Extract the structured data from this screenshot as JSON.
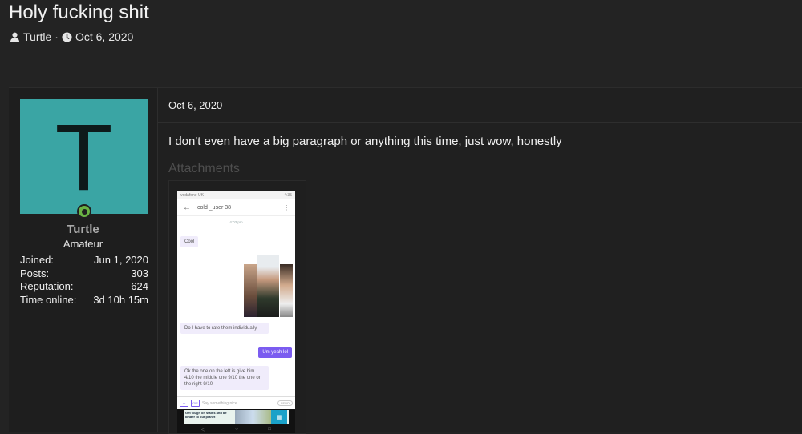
{
  "thread": {
    "title": "Holy fucking shit",
    "author": "Turtle",
    "separator": "·",
    "date": "Oct 6, 2020"
  },
  "user": {
    "avatar_letter": "T",
    "username": "Turtle",
    "title": "Amateur",
    "stats": [
      {
        "label": "Joined:",
        "value": "Jun 1, 2020"
      },
      {
        "label": "Posts:",
        "value": "303"
      },
      {
        "label": "Reputation:",
        "value": "624"
      },
      {
        "label": "Time online:",
        "value": "3d 10h 15m"
      }
    ]
  },
  "post": {
    "date": "Oct 6, 2020",
    "body": "I don't even have a big paragraph or anything this time, just wow, honestly",
    "attachments_label": "Attachments"
  },
  "screenshot": {
    "carrier": "vodafone UK",
    "clock": "4:35",
    "contact": "cold _user 38",
    "time_divider": "4:03 pm",
    "messages": [
      {
        "dir": "in",
        "text": "Cool"
      },
      {
        "dir": "in",
        "text": "Do I have to rate them individually"
      },
      {
        "dir": "out",
        "text": "Um yeah lol"
      },
      {
        "dir": "in",
        "text": "Ok the one on the left is give him 4/10  the middle one 9/10 the one on the right 9/10"
      }
    ],
    "input_placeholder": "Say something nice...",
    "gif_label": "GIF",
    "send_label": "SEND",
    "ad_text": "Get tough on stains and be kinder to our planet"
  },
  "colors": {
    "background": "#232323",
    "avatar": "#3aa5a4",
    "online": "#6ab344",
    "accent_purple": "#7b5cf0"
  },
  "icons": {
    "author": "user-icon",
    "date": "clock-icon",
    "online": "online-status-icon"
  }
}
